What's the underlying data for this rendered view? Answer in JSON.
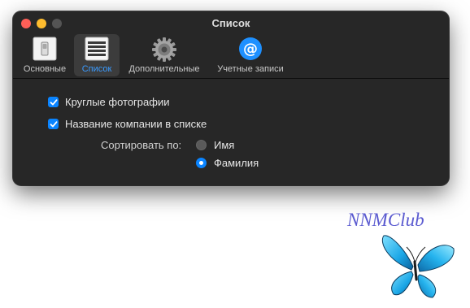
{
  "window": {
    "title": "Список"
  },
  "toolbar": {
    "items": [
      {
        "label": "Основные",
        "icon": "switch-icon",
        "selected": false
      },
      {
        "label": "Список",
        "icon": "list-icon",
        "selected": true
      },
      {
        "label": "Дополнительные",
        "icon": "gear-icon",
        "selected": false
      },
      {
        "label": "Учетные записи",
        "icon": "at-icon",
        "selected": false
      }
    ]
  },
  "settings": {
    "round_photos": {
      "label": "Круглые фотографии",
      "checked": true
    },
    "company_name": {
      "label": "Название компании в списке",
      "checked": true
    },
    "sort": {
      "label": "Сортировать по:",
      "options": [
        {
          "label": "Имя",
          "selected": false
        },
        {
          "label": "Фамилия",
          "selected": true
        }
      ]
    }
  },
  "watermark": {
    "text": "NNMClub"
  },
  "colors": {
    "accent": "#0a84ff",
    "window_bg": "#272727",
    "close": "#fe5f57",
    "minimize": "#febc2e"
  }
}
